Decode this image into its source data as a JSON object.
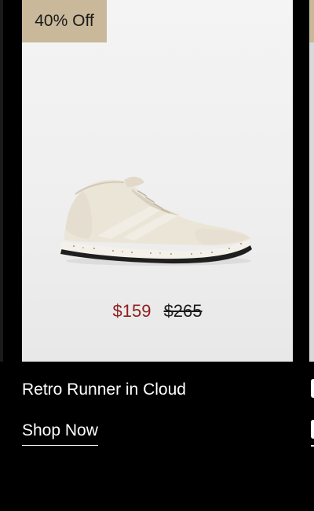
{
  "product": {
    "badge": "40% Off",
    "sale_price": "$159",
    "original_price": "$265",
    "name": "Retro Runner in Cloud",
    "cta": "Shop Now",
    "shoe_color": "#ebe5d8",
    "sale_color": "#8f1d1d",
    "badge_color": "#c9b99a"
  },
  "icons": {
    "product_image": "sneaker-image"
  }
}
